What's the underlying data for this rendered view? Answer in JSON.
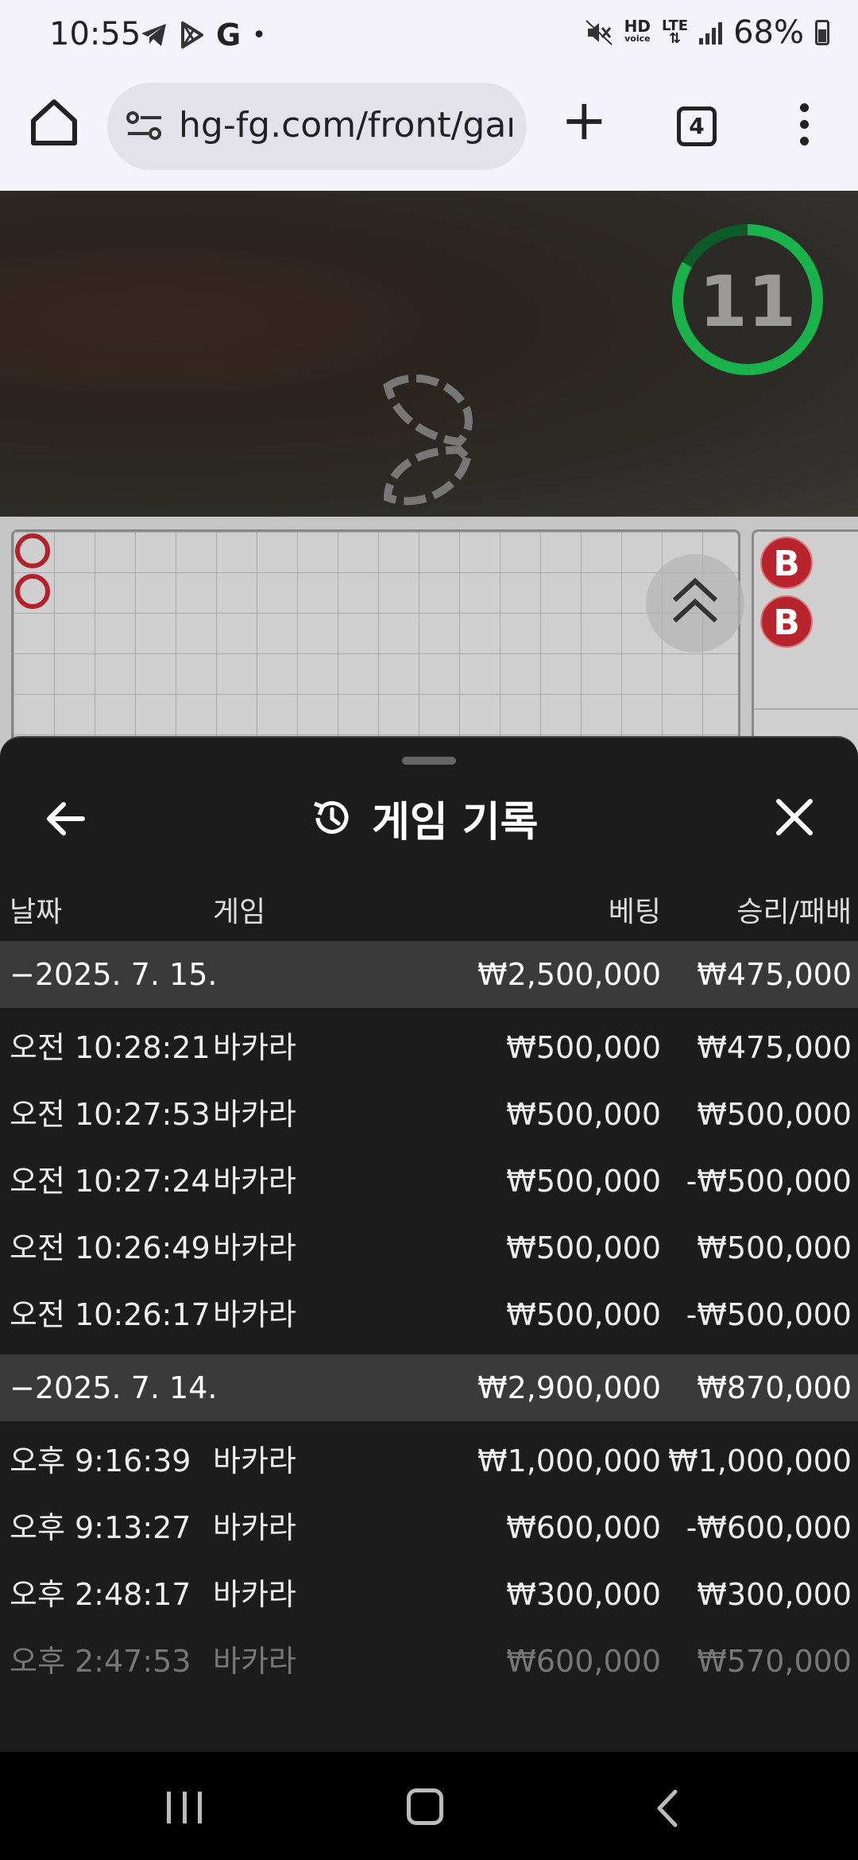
{
  "status_bar": {
    "time": "10:55",
    "g_letter": "G",
    "dot": "•",
    "hd_label": "HD",
    "voice_label": "voice",
    "lte_label": "LTE",
    "battery": "68%"
  },
  "browser": {
    "url": "hg-fg.com/front/game",
    "plus": "+",
    "tab_count": "4"
  },
  "game": {
    "timer": "11",
    "bead_labels": [
      "B",
      "B"
    ]
  },
  "sheet": {
    "title": "게임 기록",
    "headers": {
      "date": "날짜",
      "game": "게임",
      "bet": "베팅",
      "win_loss": "승리/패배"
    },
    "groups": [
      {
        "date": "−2025. 7. 15.",
        "bet_total": "₩2,500,000",
        "win_total": "₩475,000",
        "rows": [
          {
            "time": "오전 10:28:21",
            "game": "바카라",
            "bet": "₩500,000",
            "win": "₩475,000"
          },
          {
            "time": "오전 10:27:53",
            "game": "바카라",
            "bet": "₩500,000",
            "win": "₩500,000"
          },
          {
            "time": "오전 10:27:24",
            "game": "바카라",
            "bet": "₩500,000",
            "win": "-₩500,000"
          },
          {
            "time": "오전 10:26:49",
            "game": "바카라",
            "bet": "₩500,000",
            "win": "₩500,000"
          },
          {
            "time": "오전 10:26:17",
            "game": "바카라",
            "bet": "₩500,000",
            "win": "-₩500,000"
          }
        ]
      },
      {
        "date": "−2025. 7. 14.",
        "bet_total": "₩2,900,000",
        "win_total": "₩870,000",
        "rows": [
          {
            "time": "오후 9:16:39",
            "game": "바카라",
            "bet": "₩1,000,000",
            "win": "₩1,000,000"
          },
          {
            "time": "오후 9:13:27",
            "game": "바카라",
            "bet": "₩600,000",
            "win": "-₩600,000"
          },
          {
            "time": "오후 2:48:17",
            "game": "바카라",
            "bet": "₩300,000",
            "win": "₩300,000"
          },
          {
            "time": "오후 2:47:53",
            "game": "바카라",
            "bet": "₩600,000",
            "win": "₩570,000"
          }
        ]
      }
    ]
  },
  "colors": {
    "timer_green": "#19b24b",
    "banker_red": "#b8242e",
    "sheet_bg": "#1c1c1c",
    "group_row_bg": "#3a3a3a"
  }
}
